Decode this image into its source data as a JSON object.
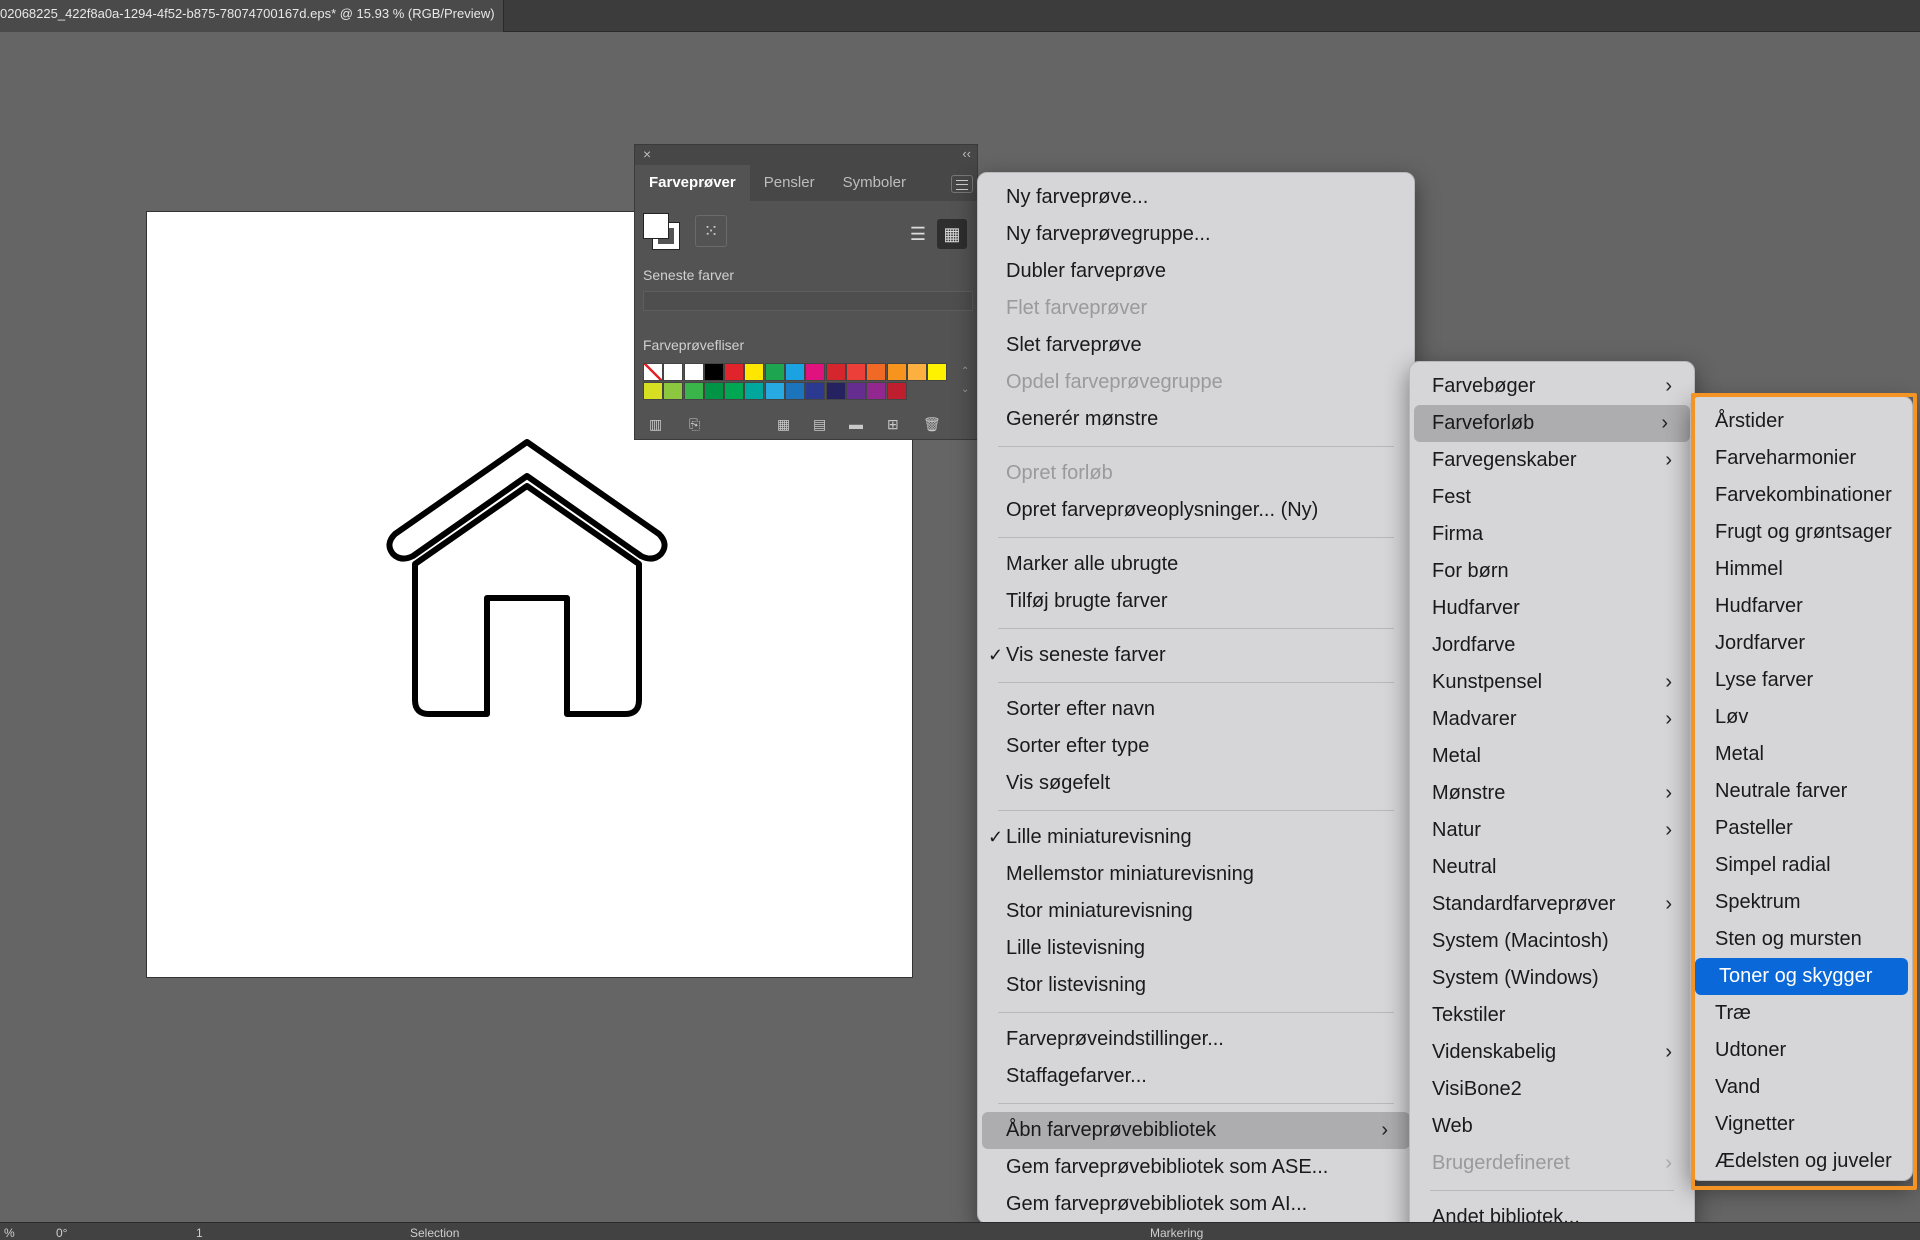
{
  "titlebar": {
    "doc_title": "02068225_422f8a0a-1294-4f52-b875-78074700167d.eps* @ 15.93 % (RGB/Preview)"
  },
  "swatches_panel": {
    "tabs": [
      "Farveprøver",
      "Pensler",
      "Symboler"
    ],
    "recent_label": "Seneste farver",
    "library_label": "Farveprøvefliser",
    "swatch_colors": [
      "#ffffff",
      "#ffffff",
      "#ffffff",
      "#000000",
      "#e1232b",
      "#ffe600",
      "#1ea54f",
      "#1ba3e1",
      "#e0127d",
      "#d4262c",
      "#ec3f3a",
      "#f16a25",
      "#f7941e",
      "#fbb040",
      "#fff200",
      "#d7df23",
      "#8dc63f",
      "#39b54a",
      "#009444",
      "#00a651",
      "#00a79d",
      "#27aae1",
      "#1c75bc",
      "#2b3990",
      "#262262",
      "#662d91",
      "#92278f",
      "#be1e2d"
    ]
  },
  "main_menu": {
    "items": [
      {
        "label": "Ny farveprøve...",
        "disabled": false
      },
      {
        "label": "Ny farveprøvegruppe...",
        "disabled": false
      },
      {
        "label": "Dubler farveprøve",
        "disabled": false
      },
      {
        "label": "Flet farveprøver",
        "disabled": true
      },
      {
        "label": "Slet farveprøve",
        "disabled": false
      },
      {
        "label": "Opdel farveprøvegruppe",
        "disabled": true
      },
      {
        "label": "Generér mønstre",
        "disabled": false
      },
      {
        "label": "Opret forløb",
        "disabled": true
      },
      {
        "label": "Opret farveprøveoplysninger... (Ny)",
        "disabled": false
      },
      {
        "label": "Marker alle ubrugte",
        "disabled": false
      },
      {
        "label": "Tilføj brugte farver",
        "disabled": false
      },
      {
        "label": "Vis seneste farver",
        "checked": true
      },
      {
        "label": "Sorter efter navn"
      },
      {
        "label": "Sorter efter type"
      },
      {
        "label": "Vis søgefelt"
      },
      {
        "label": "Lille miniaturevisning",
        "checked": true
      },
      {
        "label": "Mellemstor miniaturevisning"
      },
      {
        "label": "Stor miniaturevisning"
      },
      {
        "label": "Lille listevisning"
      },
      {
        "label": "Stor listevisning"
      },
      {
        "label": "Farveprøveindstillinger..."
      },
      {
        "label": "Staffagefarver..."
      },
      {
        "label": "Åbn farveprøvebibliotek",
        "submenu": true,
        "highlighted": true
      },
      {
        "label": "Gem farveprøvebibliotek som ASE..."
      },
      {
        "label": "Gem farveprøvebibliotek som AI..."
      }
    ],
    "check_glyph": "✓",
    "arrow_glyph": "›"
  },
  "sub1_menu": {
    "items": [
      {
        "label": "Farvebøger",
        "submenu": true
      },
      {
        "label": "Farveforløb",
        "submenu": true,
        "highlighted": true
      },
      {
        "label": "Farvegenskaber",
        "submenu": true
      },
      {
        "label": "Fest"
      },
      {
        "label": "Firma"
      },
      {
        "label": "For børn"
      },
      {
        "label": "Hudfarver"
      },
      {
        "label": "Jordfarve"
      },
      {
        "label": "Kunstpensel",
        "submenu": true
      },
      {
        "label": "Madvarer",
        "submenu": true
      },
      {
        "label": "Metal"
      },
      {
        "label": "Mønstre",
        "submenu": true
      },
      {
        "label": "Natur",
        "submenu": true
      },
      {
        "label": "Neutral"
      },
      {
        "label": "Standardfarveprøver",
        "submenu": true
      },
      {
        "label": "System (Macintosh)"
      },
      {
        "label": "System (Windows)"
      },
      {
        "label": "Tekstiler"
      },
      {
        "label": "Videnskabelig",
        "submenu": true
      },
      {
        "label": "VisiBone2"
      },
      {
        "label": "Web"
      },
      {
        "label": "Brugerdefineret",
        "submenu": true,
        "disabled": true
      },
      {
        "label": "Andet bibliotek..."
      }
    ]
  },
  "sub2_menu": {
    "items": [
      {
        "label": "Årstider"
      },
      {
        "label": "Farveharmonier"
      },
      {
        "label": "Farvekombinationer"
      },
      {
        "label": "Frugt og grøntsager"
      },
      {
        "label": "Himmel"
      },
      {
        "label": "Hudfarver"
      },
      {
        "label": "Jordfarver"
      },
      {
        "label": "Lyse farver"
      },
      {
        "label": "Løv"
      },
      {
        "label": "Metal"
      },
      {
        "label": "Neutrale farver"
      },
      {
        "label": "Pasteller"
      },
      {
        "label": "Simpel radial"
      },
      {
        "label": "Spektrum"
      },
      {
        "label": "Sten og mursten"
      },
      {
        "label": "Toner og skygger",
        "selected": true
      },
      {
        "label": "Træ"
      },
      {
        "label": "Udtoner"
      },
      {
        "label": "Vand"
      },
      {
        "label": "Vignetter"
      },
      {
        "label": "Ædelsten og juveler"
      }
    ]
  },
  "statusbar": {
    "zoom": "%",
    "rotation": "0°",
    "artboard": "1",
    "tool": "Selection",
    "right_tool": "Markering"
  },
  "colors": {
    "accent": "#0a68d8",
    "highlight_border": "#f39425"
  }
}
